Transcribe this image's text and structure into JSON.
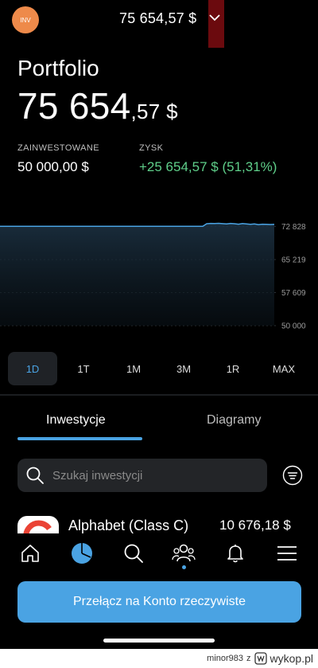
{
  "header": {
    "avatar_label": "INV",
    "total_value": "75 654,57 $"
  },
  "portfolio": {
    "title": "Portfolio",
    "value_main": "75 654",
    "value_decimal": ",57 $",
    "invested_label": "ZAINWESTOWANE",
    "invested_value": "50 000,00 $",
    "profit_label": "ZYSK",
    "profit_value": "+25 654,57 $ (51,31%)"
  },
  "chart_data": {
    "type": "area",
    "title": "",
    "xlabel": "",
    "ylabel": "",
    "y_ticks": [
      "72 828",
      "65 219",
      "57 609",
      "50 000"
    ],
    "ylim": [
      50000,
      75654.57
    ],
    "series": [
      {
        "values": [
          72850,
          72850,
          72850,
          72850,
          72850,
          72850,
          72850,
          72850,
          72850,
          72850,
          72850,
          72850,
          72850,
          72850,
          72850,
          72850,
          72850,
          72850,
          72850,
          72850,
          72850,
          72850,
          72850,
          72850,
          72850,
          72850,
          72850,
          72850,
          72850,
          72850,
          72850,
          72850,
          72850,
          72850,
          72850,
          72850,
          72850,
          72850,
          72850,
          72850,
          72850,
          72850,
          72850,
          72850,
          72850,
          72850,
          72850,
          72850,
          72850,
          72850,
          72850,
          72850,
          73450,
          73530,
          73500,
          73550,
          73480,
          73400,
          73520,
          73450,
          73350,
          73500,
          73420,
          73300,
          73400,
          73250,
          73350,
          73300,
          73280,
          73300
        ]
      }
    ],
    "line_color": "#4aa3e3",
    "grid": true
  },
  "ranges": [
    "1D",
    "1T",
    "1M",
    "3M",
    "1R",
    "MAX"
  ],
  "active_range": "1D",
  "tabs": {
    "investments": "Inwestycje",
    "charts": "Diagramy"
  },
  "search": {
    "placeholder": "Szukaj inwestycji"
  },
  "asset": {
    "name": "Alphabet (Class C)",
    "value": "10 676,18 $"
  },
  "cta_label": "Przełącz na Konto rzeczywiste",
  "footer": {
    "user": "minor983",
    "sep": "z",
    "brand": "wykop.pl"
  }
}
